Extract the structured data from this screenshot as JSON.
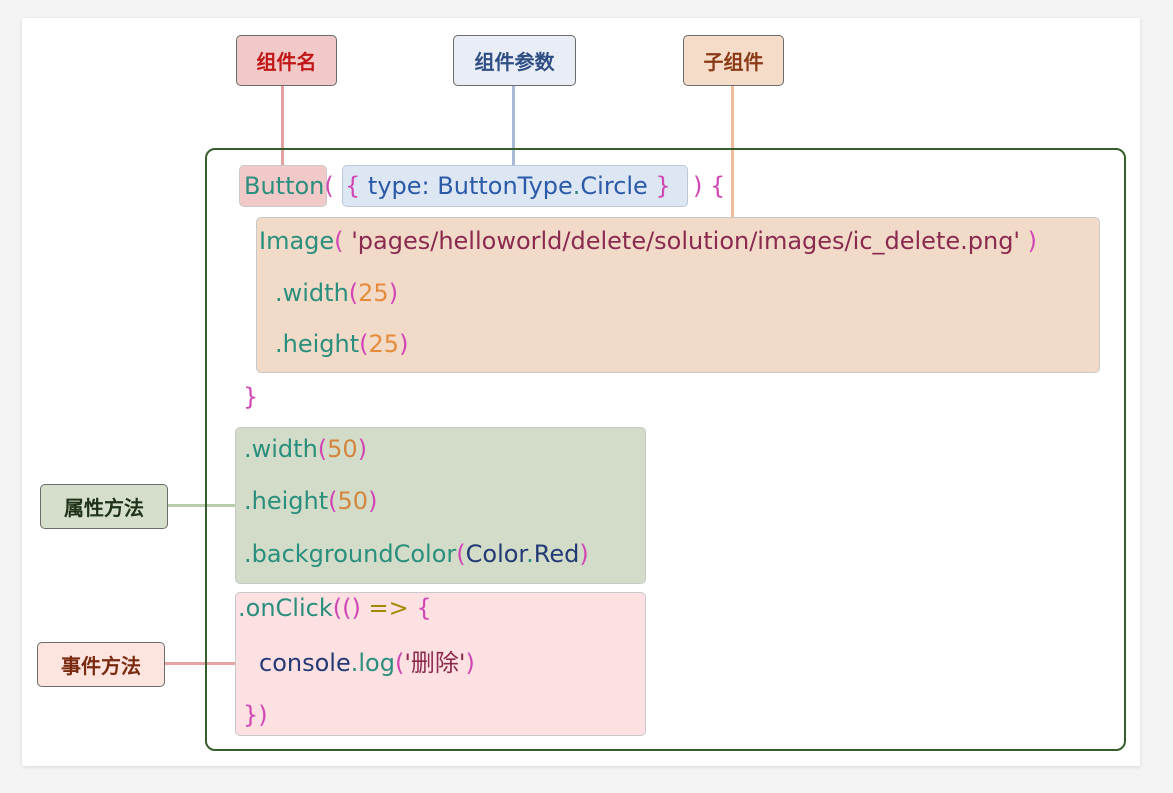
{
  "labels": {
    "component_name": "组件名",
    "component_params": "组件参数",
    "child_component": "子组件",
    "attribute_methods": "属性方法",
    "event_methods": "事件方法"
  },
  "code": {
    "button_name": "Button",
    "open_paren": "(",
    "param_open_brace": "{",
    "param_key": "type:",
    "param_type": "ButtonType",
    "param_dot": ".",
    "param_value": "Circle",
    "param_close_brace": "}",
    "close_paren_brace": ") {",
    "image_name": "Image",
    "image_open": "(",
    "image_path": "'pages/helloworld/delete/solution/images/ic_delete.png'",
    "image_close": ")",
    "image_width_method": ".width",
    "image_width_open": "(",
    "image_width_value": "25",
    "image_width_close": ")",
    "image_height_method": ".height",
    "image_height_open": "(",
    "image_height_value": "25",
    "image_height_close": ")",
    "close_brace": "}",
    "width_method": ".width",
    "width_open": "(",
    "width_value": "50",
    "width_close": ")",
    "height_method": ".height",
    "height_open": "(",
    "height_value": "50",
    "height_close": ")",
    "bg_method": ".backgroundColor",
    "bg_open": "(",
    "bg_class": "Color",
    "bg_dot": ".",
    "bg_value": "Red",
    "bg_close": ")",
    "onclick_method": ".onClick",
    "onclick_open": "((",
    "onclick_close_paren": ")",
    "onclick_arrow": " => ",
    "onclick_brace": "{",
    "console_obj": "console",
    "console_dot": ".",
    "console_method": "log",
    "console_open": "(",
    "console_arg": "'删除'",
    "console_close": ")",
    "end_brace": "}",
    "end_paren": ")"
  },
  "colors": {
    "frame_border": "#355e2c",
    "name_fill": "#f2c9c9",
    "params_fill": "#dde7f3",
    "child_fill": "#f2dac8",
    "attr_fill": "#d2dcc8",
    "event_fill": "#fde0e1"
  }
}
